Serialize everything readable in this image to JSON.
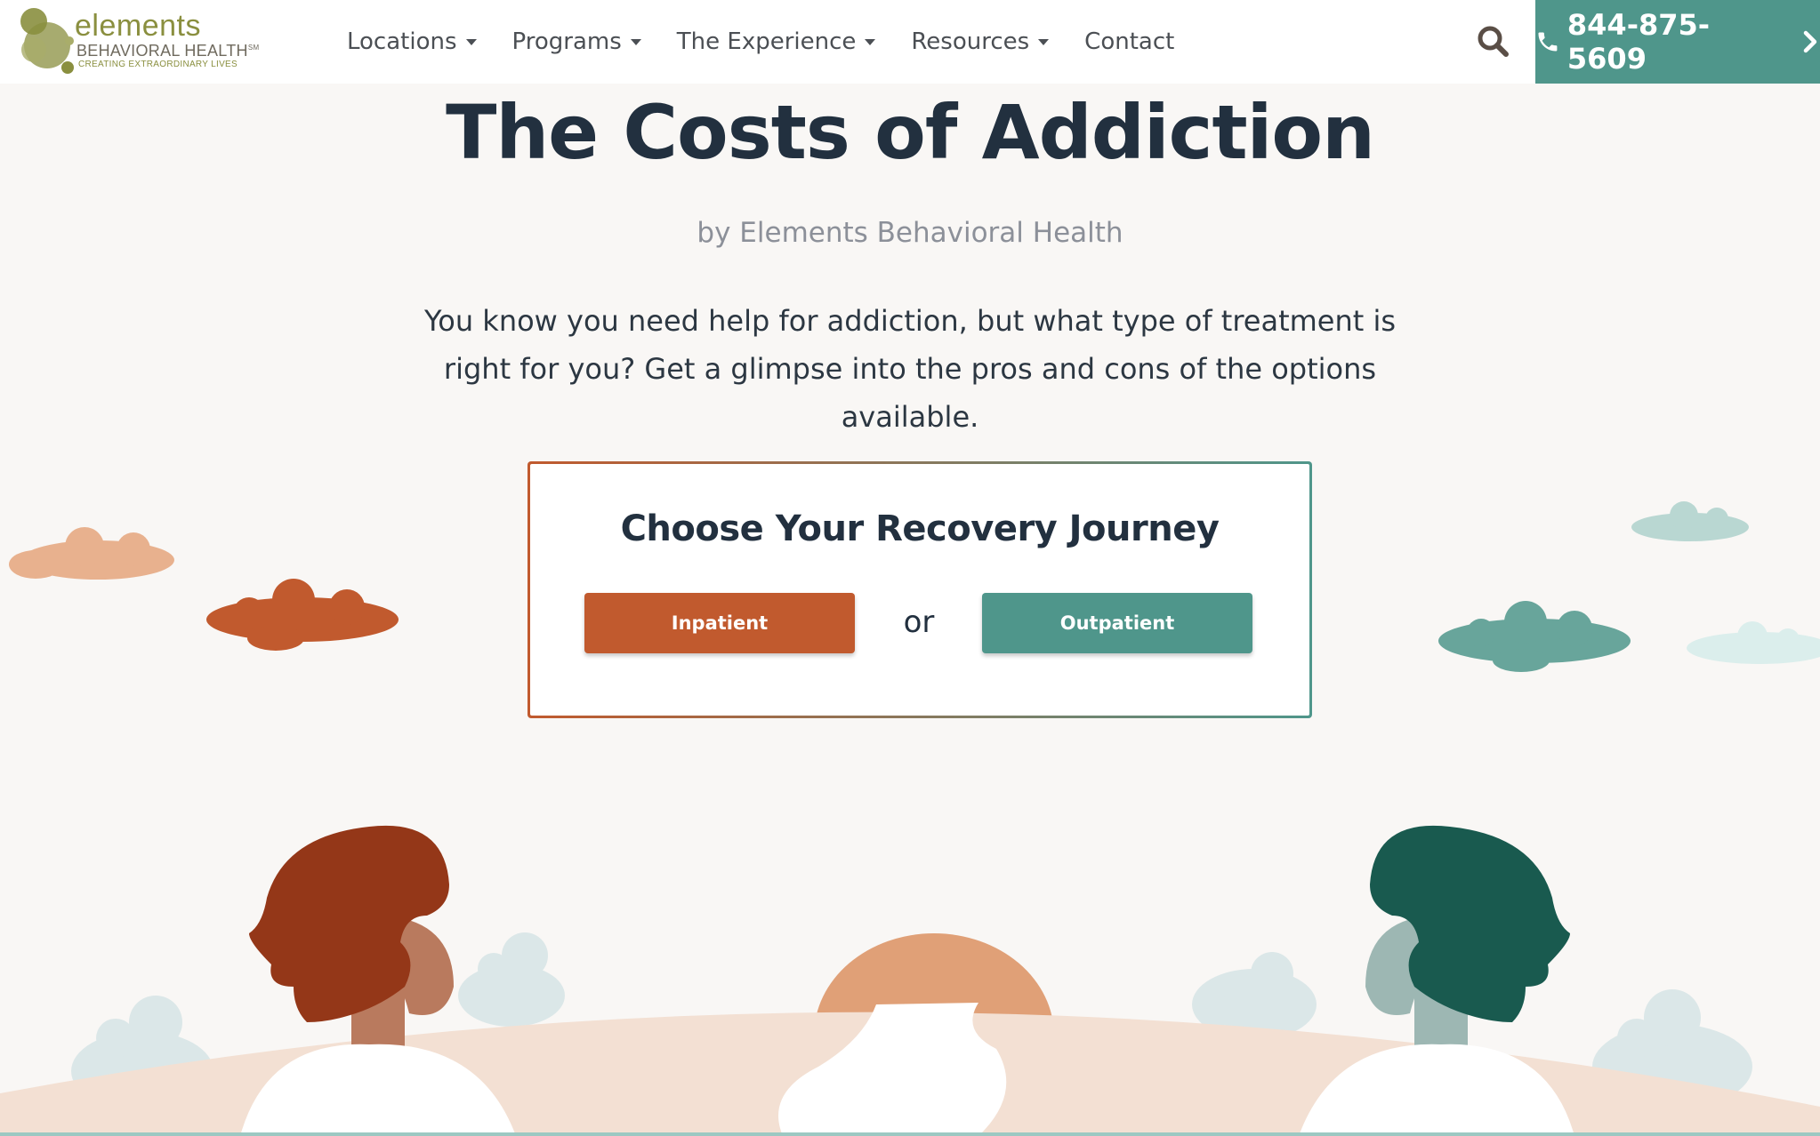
{
  "header": {
    "logo": {
      "word": "elements",
      "sub": "BEHAVIORAL HEALTH",
      "mark": "SM",
      "tagline": "CREATING EXTRAORDINARY LIVES"
    },
    "nav": [
      {
        "label": "Locations",
        "dropdown": true
      },
      {
        "label": "Programs",
        "dropdown": true
      },
      {
        "label": "The Experience",
        "dropdown": true
      },
      {
        "label": "Resources",
        "dropdown": true
      },
      {
        "label": "Contact",
        "dropdown": false
      }
    ],
    "search_icon": "search-icon",
    "phone": {
      "number": "844-875-5609",
      "icon": "phone-icon",
      "arrow_icon": "chevron-right-icon"
    }
  },
  "hero": {
    "title": "The Costs of Addiction",
    "byline": "by Elements Behavioral Health",
    "intro": "You know you need help for addiction, but what type of treatment is right for you? Get a glimpse into the pros and cons of the options available."
  },
  "choice": {
    "title": "Choose Your Recovery Journey",
    "inpatient_label": "Inpatient",
    "or_label": "or",
    "outpatient_label": "Outpatient"
  },
  "colors": {
    "accent_orange": "#c15a2e",
    "accent_teal": "#4f968b",
    "heading": "#22303f",
    "background": "#f9f7f5"
  }
}
